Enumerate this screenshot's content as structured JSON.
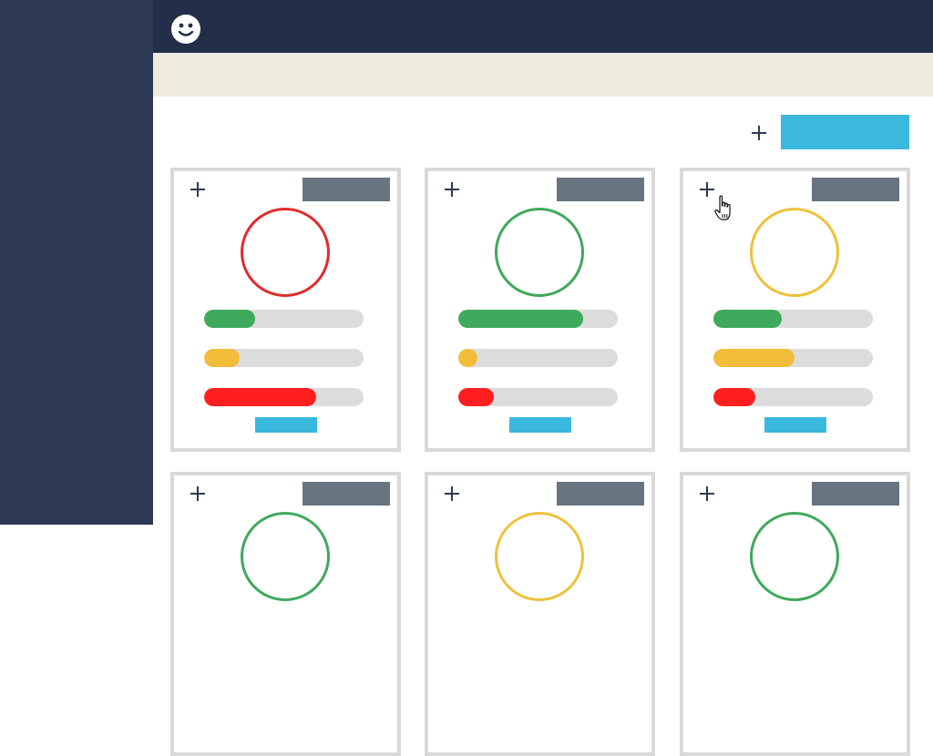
{
  "colors": {
    "sidebar": "#2e3a55",
    "topbar": "#232f48",
    "subbar": "#edecdf",
    "accent": "#3ab8de",
    "tag": "#68747f",
    "track": "#dcdcdc",
    "card_border": "#d9d9d9",
    "green": "#3fa95c",
    "yellow": "#f2be3a",
    "red": "#ff1f1f",
    "ring_red": "#e12b2b",
    "ring_green": "#3fa95c",
    "ring_yellow": "#efc13b"
  },
  "icons": {
    "logo": "smiley-face-icon",
    "add": "plus-icon",
    "cursor": "hand-pointer-cursor-icon"
  },
  "cards": [
    {
      "ring_status": "red",
      "bars": [
        {
          "color": "green",
          "fill": 0.32
        },
        {
          "color": "yellow",
          "fill": 0.22
        },
        {
          "color": "red",
          "fill": 0.7
        }
      ]
    },
    {
      "ring_status": "green",
      "bars": [
        {
          "color": "green",
          "fill": 0.78
        },
        {
          "color": "yellow",
          "fill": 0.12
        },
        {
          "color": "red",
          "fill": 0.22
        }
      ]
    },
    {
      "ring_status": "yellow",
      "bars": [
        {
          "color": "green",
          "fill": 0.43
        },
        {
          "color": "yellow",
          "fill": 0.51
        },
        {
          "color": "red",
          "fill": 0.26
        }
      ]
    },
    {
      "ring_status": "green",
      "bars": []
    },
    {
      "ring_status": "yellow",
      "bars": []
    },
    {
      "ring_status": "green",
      "bars": []
    }
  ]
}
